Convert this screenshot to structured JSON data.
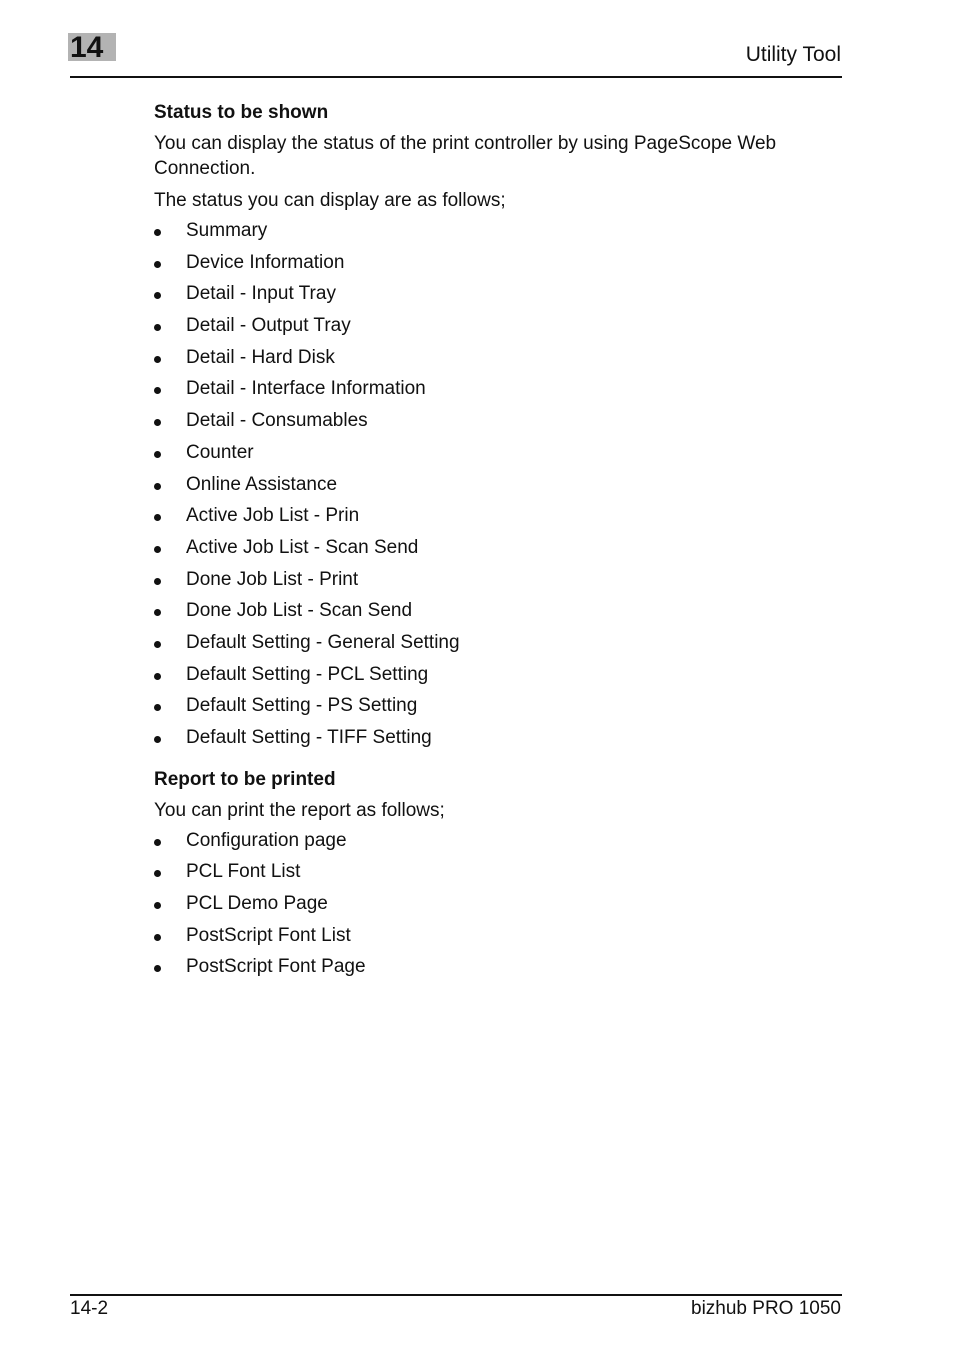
{
  "header": {
    "chapter_number": "14",
    "title": "Utility Tool"
  },
  "section1": {
    "heading": "Status to be shown",
    "intro": "You can display the status of the print controller by using PageScope Web Connection.",
    "lead": "The status you can display are as follows;",
    "items": [
      "Summary",
      "Device Information",
      "Detail - Input Tray",
      "Detail - Output Tray",
      "Detail - Hard Disk",
      "Detail - Interface Information",
      "Detail - Consumables",
      "Counter",
      "Online Assistance",
      "Active Job List - Prin",
      "Active Job List - Scan Send",
      "Done Job List - Print",
      "Done Job List - Scan Send",
      "Default Setting - General Setting",
      "Default Setting - PCL Setting",
      "Default Setting - PS Setting",
      "Default Setting - TIFF Setting"
    ]
  },
  "section2": {
    "heading": "Report to be printed",
    "lead": "You can print the report as follows;",
    "items": [
      "Configuration page",
      "PCL Font List",
      "PCL Demo Page",
      "PostScript Font List",
      "PostScript Font Page"
    ]
  },
  "footer": {
    "page_number": "14-2",
    "product": "bizhub PRO 1050"
  }
}
